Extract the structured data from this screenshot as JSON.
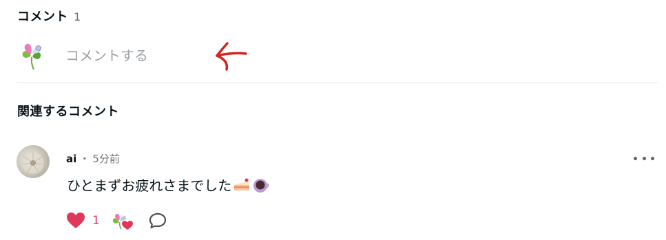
{
  "comments": {
    "title": "コメント",
    "count": "1",
    "input": {
      "placeholder": "コメントする",
      "value": ""
    }
  },
  "related": {
    "title": "関連するコメント",
    "items": [
      {
        "user": "ai",
        "separator": "・",
        "time": "5分前",
        "text": "ひとまずお疲れさまでした",
        "emojis": [
          "cake-icon",
          "coffee-icon"
        ],
        "like_count": "1"
      }
    ]
  },
  "colors": {
    "like": "#e0385b",
    "annotation_arrow": "#d62222",
    "muted_text": "#6b7378",
    "placeholder": "#9aa0a3"
  },
  "icons": [
    "clover-avatar-icon",
    "red-arrow-annotation",
    "heart-icon",
    "reply-bubble-icon",
    "more-dots-icon"
  ]
}
